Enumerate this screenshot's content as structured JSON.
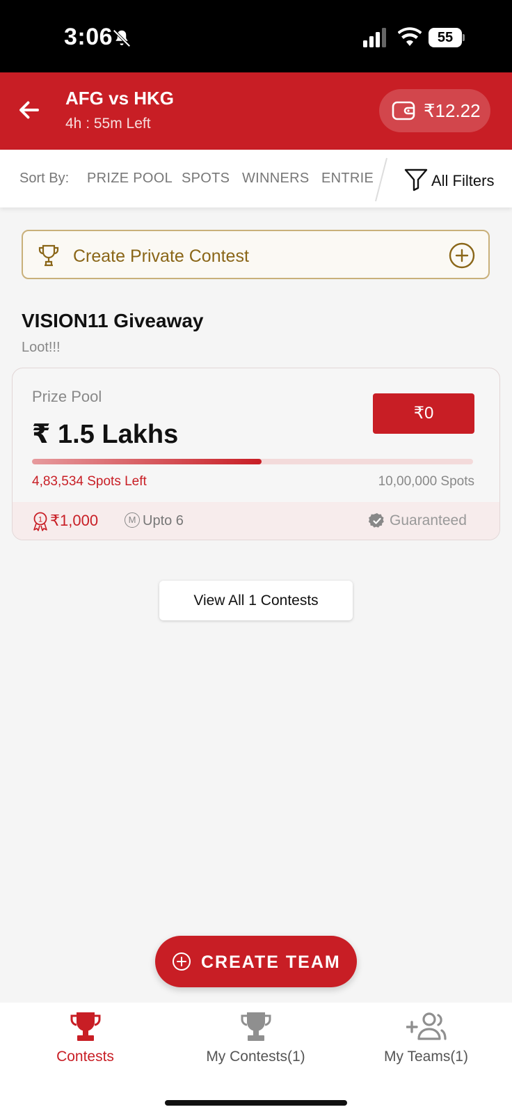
{
  "status_bar": {
    "time": "3:06",
    "battery": "55"
  },
  "header": {
    "title": "AFG vs HKG",
    "time_left": "4h : 55m Left",
    "wallet_amount": "₹12.22"
  },
  "sort_bar": {
    "label": "Sort By:",
    "options": [
      "PRIZE POOL",
      "SPOTS",
      "WINNERS",
      "ENTRIE"
    ],
    "filters_label": "All Filters"
  },
  "private_contest": {
    "label": "Create Private Contest"
  },
  "section": {
    "title": "VISION11 Giveaway",
    "subtitle": "Loot!!!"
  },
  "contest": {
    "prize_pool_label": "Prize Pool",
    "prize_pool": "₹ 1.5 Lakhs",
    "entry_fee": "₹0",
    "filled_fraction": 0.52,
    "spots_left": "4,83,534 Spots Left",
    "total_spots": "10,00,000 Spots",
    "first_prize": "₹1,000",
    "max_entries": "Upto 6",
    "max_entries_badge": "M",
    "guaranteed": "Guaranteed"
  },
  "view_all": {
    "label": "View All 1 Contests"
  },
  "create_team": {
    "label": "CREATE TEAM"
  },
  "bottom_nav": {
    "items": [
      {
        "label": "Contests",
        "icon": "trophy-icon",
        "active": true
      },
      {
        "label": "My Contests(1)",
        "icon": "trophy-icon",
        "active": false
      },
      {
        "label": "My Teams(1)",
        "icon": "add-user-icon",
        "active": false
      }
    ]
  },
  "colors": {
    "brand": "#c81e25",
    "gold": "#8a6618",
    "inactive": "#777777"
  }
}
